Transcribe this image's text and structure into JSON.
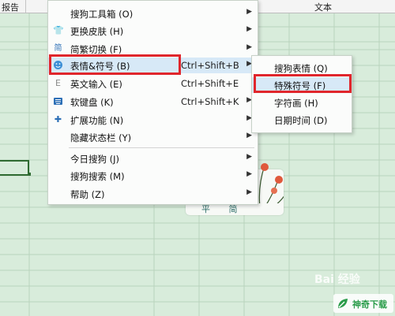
{
  "topbar": {
    "left_label": "报告",
    "right_label": "文本"
  },
  "card": {
    "text": "平 简"
  },
  "main_menu": {
    "items": [
      {
        "label": "搜狗工具箱 (O)",
        "icon": "none",
        "shortcut": "",
        "arrow": true
      },
      {
        "label": "更换皮肤 (H)",
        "icon": "shirt-icon",
        "shortcut": "",
        "arrow": true
      },
      {
        "label": "简繁切换 (F)",
        "icon": "jian-icon",
        "shortcut": "",
        "arrow": true
      },
      {
        "label": "表情&符号 (B)",
        "icon": "smiley-icon",
        "shortcut": "Ctrl+Shift+B",
        "arrow": true
      },
      {
        "label": "英文输入 (E)",
        "icon": "e-icon",
        "shortcut": "Ctrl+Shift+E",
        "arrow": false
      },
      {
        "label": "软键盘 (K)",
        "icon": "keyboard-icon",
        "shortcut": "Ctrl+Shift+K",
        "arrow": true
      },
      {
        "label": "扩展功能 (N)",
        "icon": "puzzle-icon",
        "shortcut": "",
        "arrow": true
      },
      {
        "label": "隐藏状态栏 (Y)",
        "icon": "none",
        "shortcut": "",
        "arrow": true
      },
      {
        "label": "今日搜狗 (J)",
        "icon": "none",
        "shortcut": "",
        "arrow": true
      },
      {
        "label": "搜狗搜索 (M)",
        "icon": "none",
        "shortcut": "",
        "arrow": true
      },
      {
        "label": "帮助 (Z)",
        "icon": "none",
        "shortcut": "",
        "arrow": true
      }
    ]
  },
  "sub_menu": {
    "items": [
      {
        "label": "搜狗表情 (Q)"
      },
      {
        "label": "特殊符号 (F)"
      },
      {
        "label": "字符画 (H)"
      },
      {
        "label": "日期时间 (D)"
      }
    ]
  },
  "watermark": {
    "text": "Bai 经验"
  },
  "brand_logo": {
    "text": "神奇下载"
  },
  "colors": {
    "highlight_box": "#e0262c",
    "menu_hover": "#d7e9f7",
    "sheet_bg": "#d8ecdb"
  }
}
